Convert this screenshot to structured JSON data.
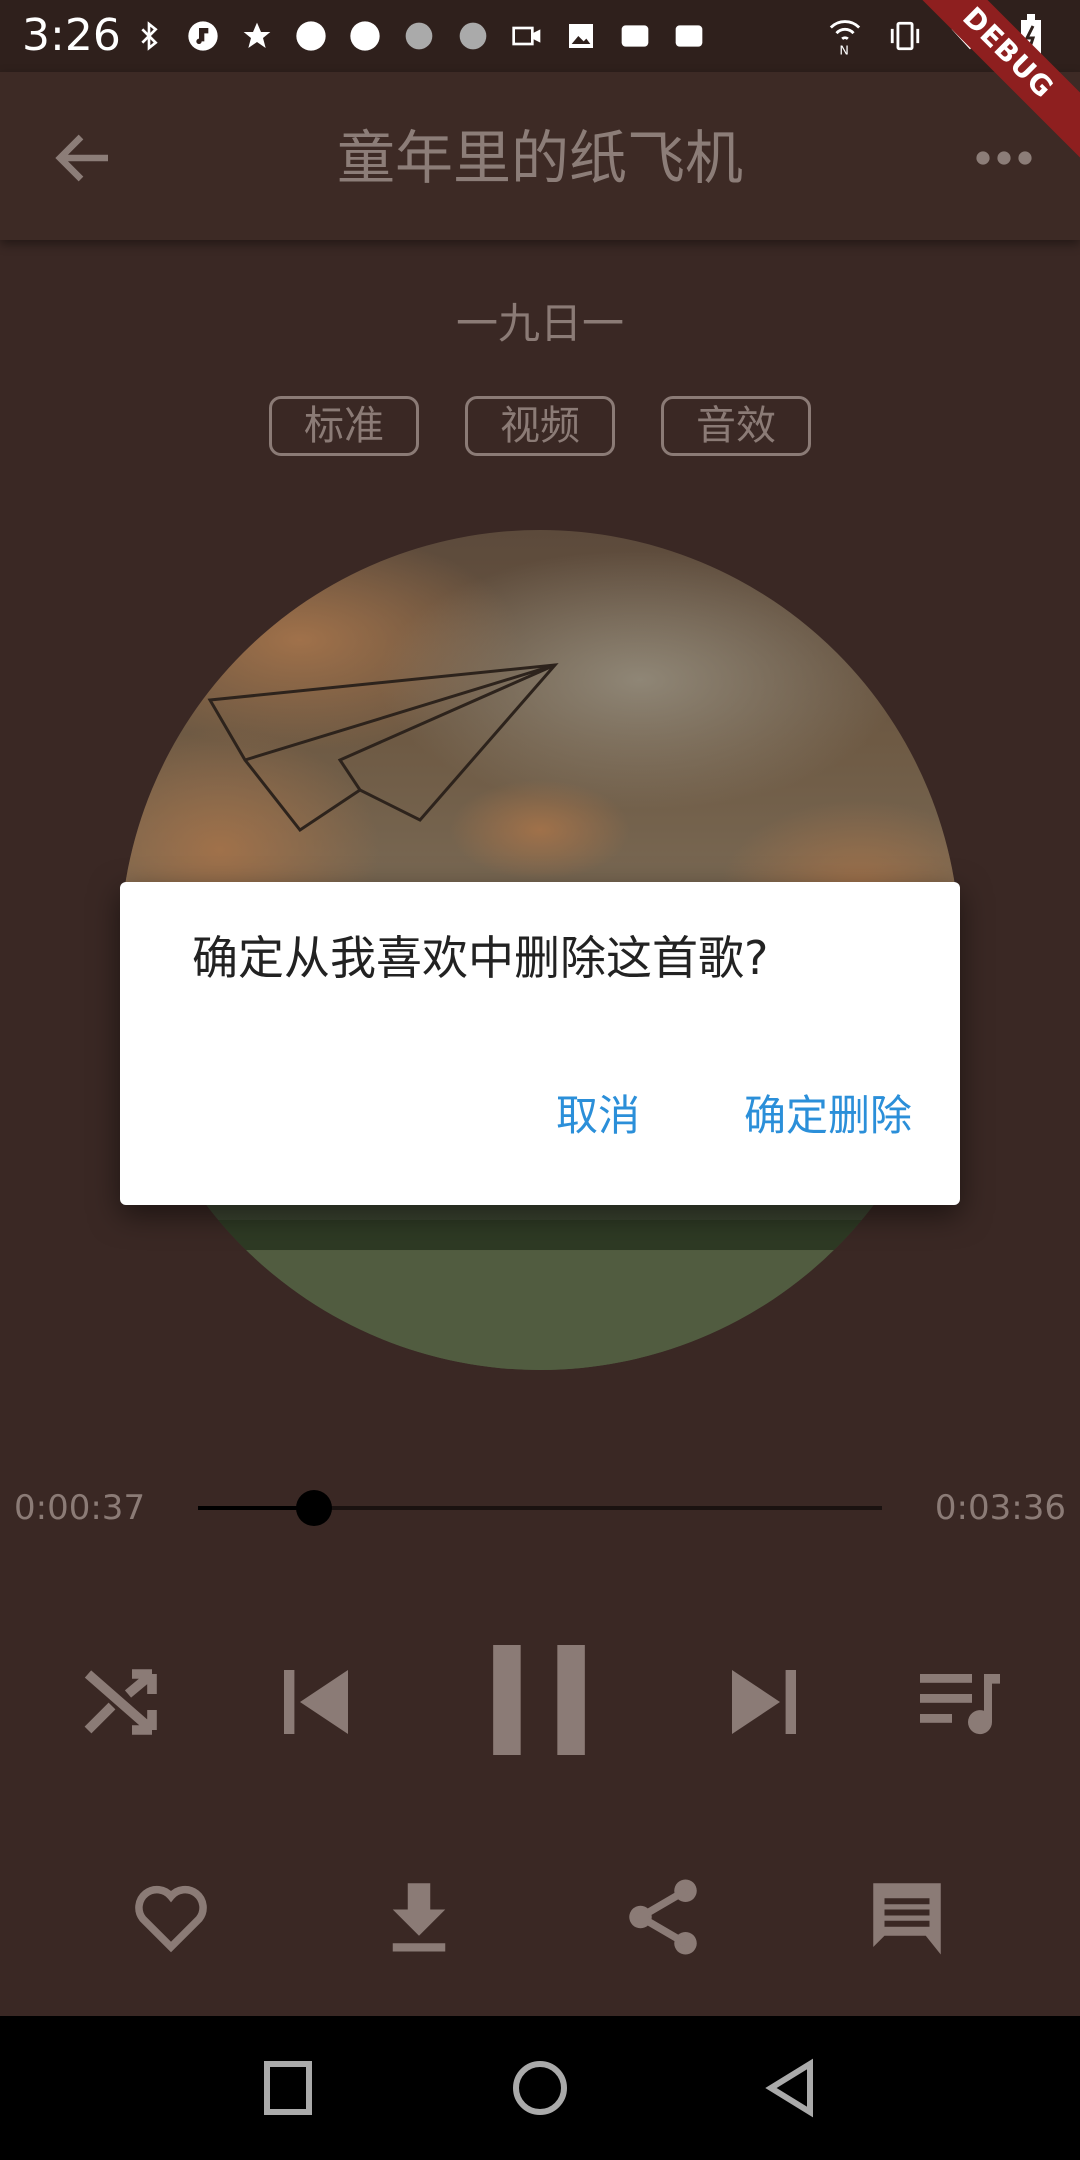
{
  "status_bar": {
    "time": "3:26"
  },
  "debug_label": "DEBUG",
  "app_bar": {
    "title": "童年里的纸飞机"
  },
  "song": {
    "artist": "一九日一",
    "chips": [
      "标准",
      "视频",
      "音效"
    ]
  },
  "player": {
    "current_time": "0:00:37",
    "total_time": "0:03:36",
    "progress": 0.17
  },
  "dialog": {
    "message": "确定从我喜欢中删除这首歌?",
    "cancel_label": "取消",
    "confirm_label": "确定删除"
  },
  "colors": {
    "background": "#3a2824",
    "muted_text": "#8b7b76",
    "dialog_button": "#2b8fd9"
  },
  "icons": {
    "back": "arrow-back-icon",
    "more": "more-horizontal-icon",
    "shuffle": "shuffle-icon",
    "previous": "skip-previous-icon",
    "pause": "pause-icon",
    "next": "skip-next-icon",
    "playlist": "playlist-music-icon",
    "like": "heart-outline-icon",
    "download": "download-icon",
    "share": "share-icon",
    "comment": "comment-icon"
  }
}
